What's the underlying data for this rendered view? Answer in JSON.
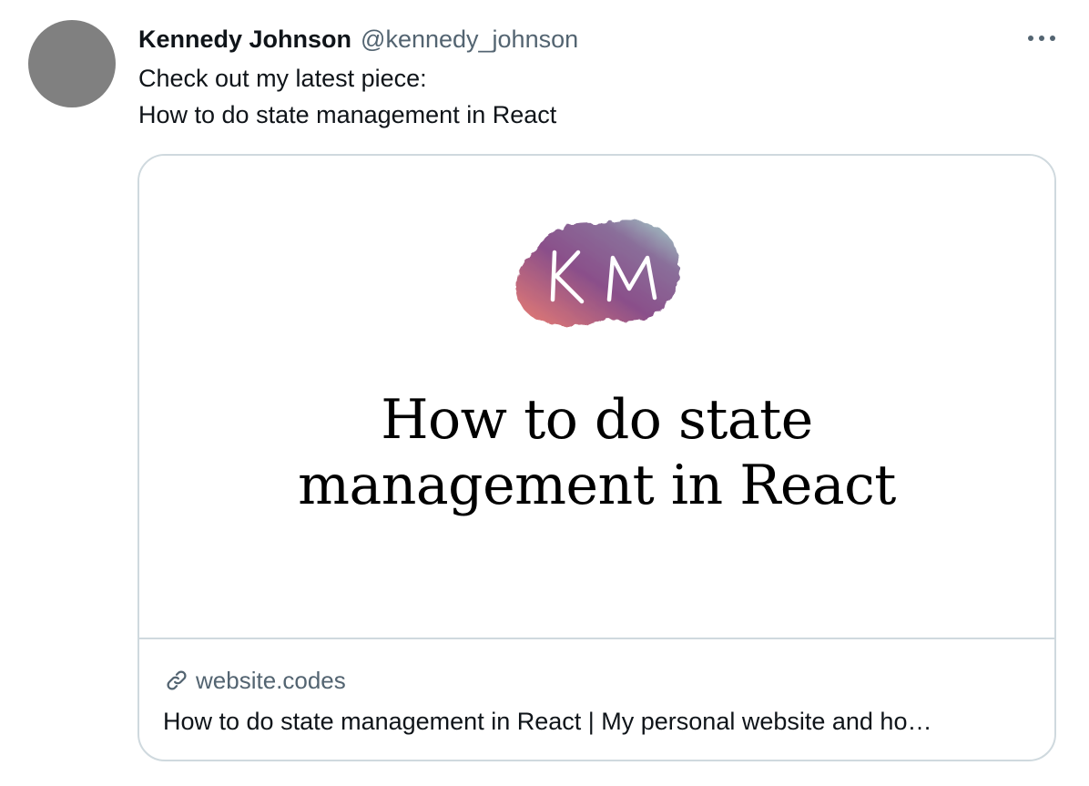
{
  "tweet": {
    "author_name": "Kennedy Johnson",
    "author_handle": "@kennedy_johnson",
    "text_line1": "Check out my latest piece:",
    "text_line2": "How to do state management in React",
    "more_icon": "more-horizontal-icon"
  },
  "card": {
    "logo_text": "KM",
    "headline_line1": "How to do state",
    "headline_line2": "management in React",
    "domain": "website.codes",
    "title": "How to do state management in React | My personal website and ho…",
    "link_icon": "link-icon"
  },
  "colors": {
    "avatar": "#808080",
    "handle": "#536471",
    "border": "#cfd9de",
    "logo_purple": "#8a5a8c",
    "logo_teal": "#9ad0c8",
    "logo_coral": "#e07a7a"
  }
}
